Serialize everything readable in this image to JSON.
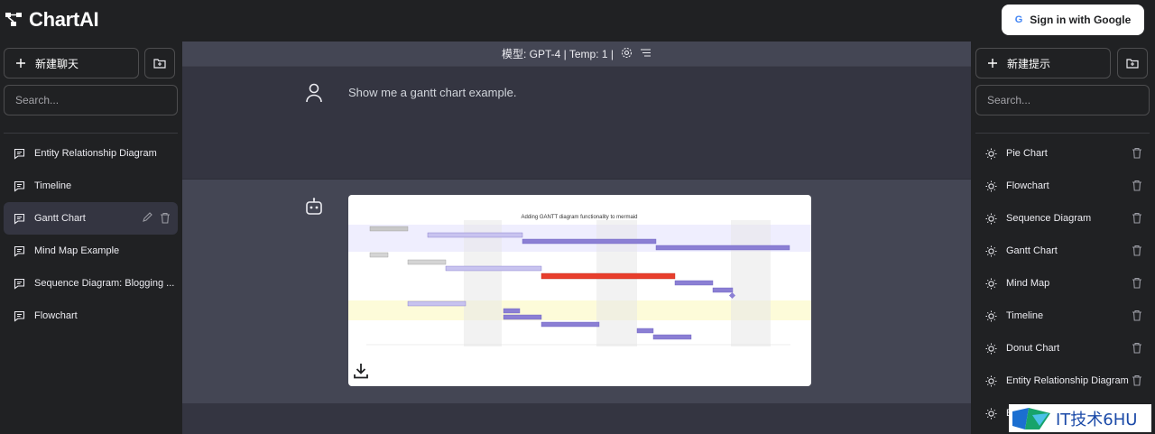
{
  "app": {
    "title": "ChartAI"
  },
  "header": {
    "signin_label": "Sign in with Google",
    "google_icon": "G"
  },
  "left_sidebar": {
    "new_button": "新建聊天",
    "search_placeholder": "Search...",
    "items": [
      {
        "label": "Entity Relationship Diagram",
        "active": false
      },
      {
        "label": "Timeline",
        "active": false
      },
      {
        "label": "Gantt Chart",
        "active": true
      },
      {
        "label": "Mind Map Example",
        "active": false
      },
      {
        "label": "Sequence Diagram: Blogging ...",
        "active": false
      },
      {
        "label": "Flowchart",
        "active": false
      }
    ]
  },
  "right_sidebar": {
    "new_button": "新建提示",
    "search_placeholder": "Search...",
    "items": [
      {
        "label": "Pie Chart"
      },
      {
        "label": "Flowchart"
      },
      {
        "label": "Sequence Diagram"
      },
      {
        "label": "Gantt Chart"
      },
      {
        "label": "Mind Map"
      },
      {
        "label": "Timeline"
      },
      {
        "label": "Donut Chart"
      },
      {
        "label": "Entity Relationship Diagram"
      },
      {
        "label": "B"
      }
    ]
  },
  "main": {
    "model_label": "模型: GPT-4 | Temp: 1 |",
    "user_message": "Show me a gantt chart example.",
    "chart_title": "Adding GANTT diagram functionality to mermaid"
  },
  "watermark": {
    "text": "IT技术6HU"
  },
  "colors": {
    "bg": "#202123",
    "main": "#343541",
    "bot": "#444654",
    "accent_bar": "#8b7fd4",
    "critical_bar": "#e83e2c"
  }
}
